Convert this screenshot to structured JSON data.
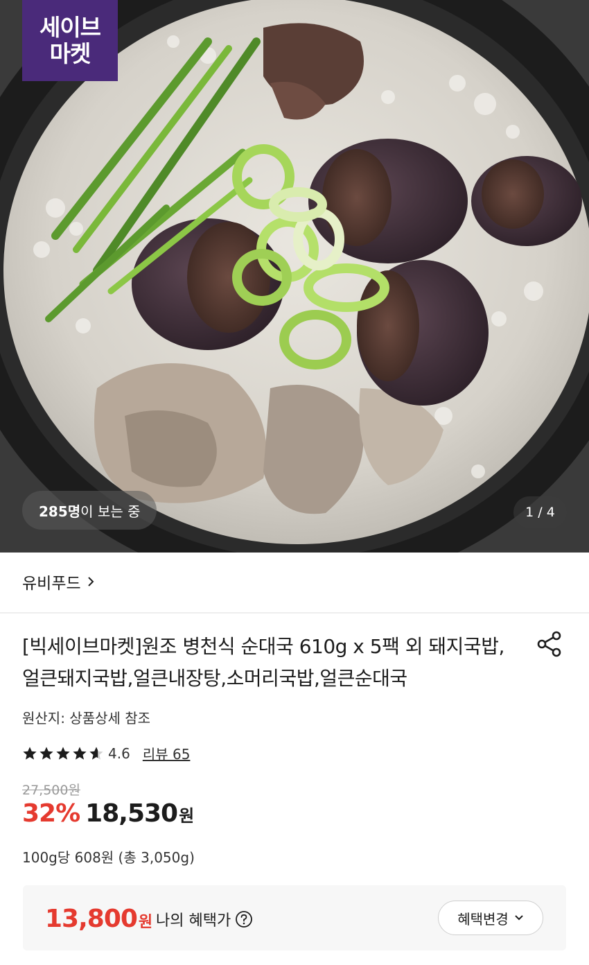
{
  "hero": {
    "badge_line1": "세이브",
    "badge_line2": "마켓",
    "viewers_count": "285명",
    "viewers_suffix": "이 보는 중",
    "pager": "1 / 4"
  },
  "seller": {
    "name": "유비푸드"
  },
  "product": {
    "title": "[빅세이브마켓]원조 병천식 순대국 610g x 5팩 외 돼지국밥,얼큰돼지국밥,얼큰내장탕,소머리국밥,얼큰순대국",
    "origin": "원산지: 상품상세 참조",
    "rating": {
      "value_text": "4.6",
      "stars_value": 4.6,
      "max": 5,
      "review_link": "리뷰 65"
    },
    "original_price": "27,500원",
    "discount": "32%",
    "price": "18,530",
    "currency": "원",
    "unit_price": "100g당 608원 (총 3,050g)"
  },
  "benefit": {
    "amount": "13,800",
    "currency": "원",
    "label": "나의 혜택가",
    "change_button": "혜택변경"
  },
  "icons": {
    "share": "share-icon",
    "help": "help-circle-icon",
    "chevron_right": "chevron-right-icon",
    "chevron_down": "chevron-down-icon",
    "star": "star-icon"
  },
  "colors": {
    "accent_red": "#e53a2f",
    "badge_purple": "#4a2a7a",
    "benefit_bg": "#f7f7f7"
  }
}
